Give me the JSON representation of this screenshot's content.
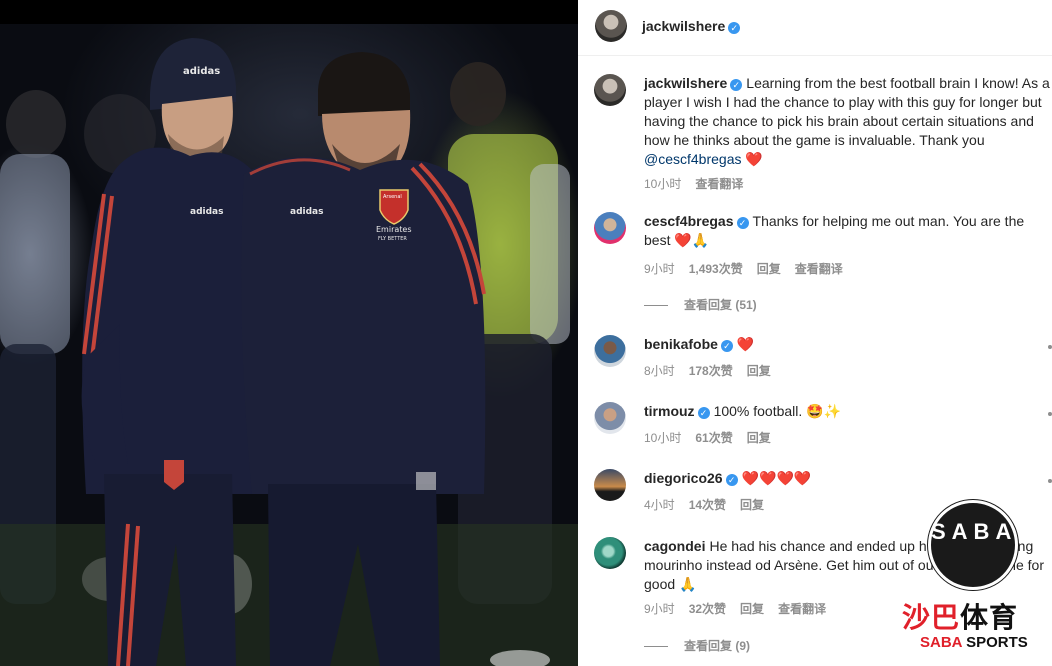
{
  "post": {
    "author": "jackwilshere",
    "caption_text": "Learning from the best football brain I know! As a player I wish I had the chance to play with this guy for longer but having the chance to pick his brain about certain situations and how he thinks about the game is invaluable. Thank you ",
    "caption_mention": "@cescf4bregas",
    "caption_time": "10小时",
    "translate_label": "查看翻译"
  },
  "comments": [
    {
      "username": "cescf4bregas",
      "text": "Thanks for helping me out man. You are the best ",
      "emoji": "❤️🙏",
      "time": "9小时",
      "likes": "1,493次赞",
      "reply_label": "回复",
      "translate_label": "查看翻译",
      "view_replies": "查看回复 (51)"
    },
    {
      "username": "benikafobe",
      "text": "",
      "emoji": "❤️",
      "time": "8小时",
      "likes": "178次赞",
      "reply_label": "回复"
    },
    {
      "username": "tirmouz",
      "text": "100% football. ",
      "emoji": "🤩✨",
      "time": "10小时",
      "likes": "61次赞",
      "reply_label": "回复"
    },
    {
      "username": "diegorico26",
      "text": "",
      "emoji": "❤️❤️❤️❤️",
      "time": "4小时",
      "likes": "14次赞",
      "reply_label": "回复"
    },
    {
      "username": "cagondei",
      "text": "He had his chance and ended up his career praising mourinho instead od Arsène. Get him out of our club this time for good ",
      "emoji": "🙏",
      "time": "9小时",
      "likes": "32次赞",
      "reply_label": "回复",
      "translate_label": "查看翻译",
      "view_replies": "查看回复 (9)"
    }
  ],
  "photo": {
    "badge_text": "Arsenal",
    "sponsor_text": "Emirates",
    "sponsor_sub": "FLY BETTER"
  },
  "watermark": {
    "ball_text": "SABA",
    "cn_text_red": "沙巴",
    "cn_text": "体育",
    "en_text_red": "SABA",
    "en_text": " SPORTS"
  },
  "colors": {
    "verified": "#3897f0",
    "heart": "#ed4956",
    "meta": "#8e8e8e",
    "mention": "#00376b",
    "watermark_red": "#e0202a"
  },
  "icons": [
    "verified-badge-icon",
    "heart-icon",
    "pray-icon",
    "star-eyes-icon",
    "sparkle-icon",
    "more-options-icon"
  ]
}
